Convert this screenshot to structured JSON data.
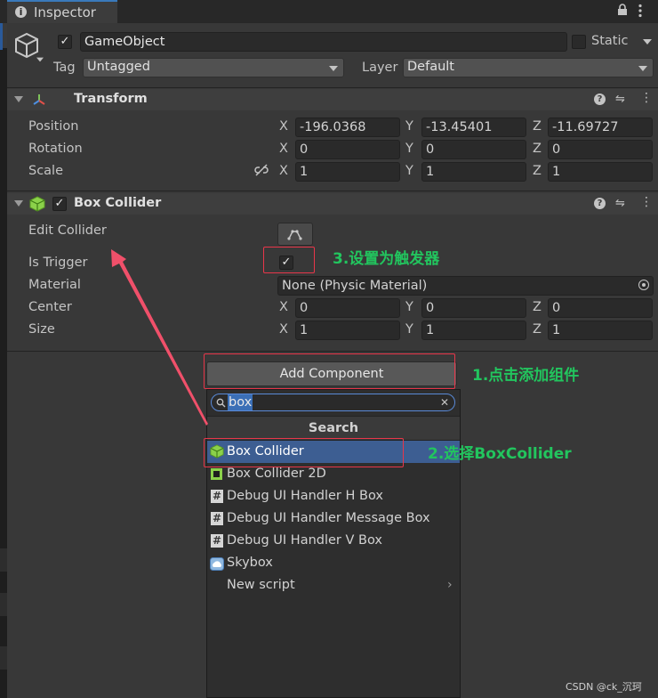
{
  "tab": {
    "title": "Inspector"
  },
  "gameobject": {
    "name": "GameObject",
    "static_label": "Static",
    "tag_label": "Tag",
    "tag_value": "Untagged",
    "layer_label": "Layer",
    "layer_value": "Default"
  },
  "transform": {
    "title": "Transform",
    "rows": [
      {
        "label": "Position",
        "x": "-196.0368",
        "y": "-13.45401",
        "z": "-11.69727"
      },
      {
        "label": "Rotation",
        "x": "0",
        "y": "0",
        "z": "0"
      },
      {
        "label": "Scale",
        "x": "1",
        "y": "1",
        "z": "1"
      }
    ]
  },
  "axis": {
    "x": "X",
    "y": "Y",
    "z": "Z"
  },
  "box_collider": {
    "title": "Box Collider",
    "edit_collider": "Edit Collider",
    "is_trigger": "Is Trigger",
    "material_label": "Material",
    "material_value": "None (Physic Material)",
    "center_label": "Center",
    "center": {
      "x": "0",
      "y": "0",
      "z": "0"
    },
    "size_label": "Size",
    "size": {
      "x": "1",
      "y": "1",
      "z": "1"
    }
  },
  "add_component": {
    "label": "Add Component"
  },
  "popup": {
    "search_value": "box",
    "header": "Search",
    "items": [
      {
        "label": "Box Collider",
        "icon": "cube-icon"
      },
      {
        "label": "Box Collider 2D",
        "icon": "square-icon"
      },
      {
        "label": "Debug UI Handler H Box",
        "icon": "hash-icon"
      },
      {
        "label": "Debug UI Handler Message Box",
        "icon": "hash-icon"
      },
      {
        "label": "Debug UI Handler V Box",
        "icon": "hash-icon"
      },
      {
        "label": "Skybox",
        "icon": "skybox-icon"
      },
      {
        "label": "New script",
        "icon": "chevron-right-icon"
      }
    ]
  },
  "annotations": {
    "step1": "1.点击添加组件",
    "step2": "2.选择BoxCollider",
    "step3": "3.设置为触发器",
    "color": "#22c55e",
    "box_color": "#e8364a"
  },
  "watermark": "CSDN @ck_沉珂"
}
